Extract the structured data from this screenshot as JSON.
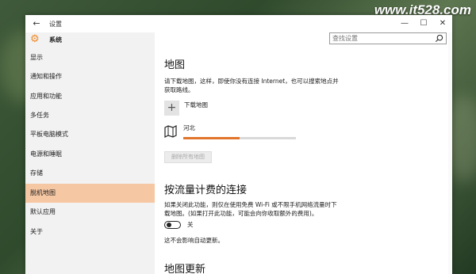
{
  "watermark": "www.it528.com",
  "window": {
    "title": "设置",
    "back_icon": "arrow-left-icon",
    "controls": {
      "minimize": "—",
      "maximize": "☐",
      "close": "✕"
    }
  },
  "sidebar": {
    "header": "系统",
    "items": [
      {
        "label": "显示"
      },
      {
        "label": "通知和操作"
      },
      {
        "label": "应用和功能"
      },
      {
        "label": "多任务"
      },
      {
        "label": "平板电脑模式"
      },
      {
        "label": "电源和睡眠"
      },
      {
        "label": "存储"
      },
      {
        "label": "脱机地图",
        "active": true
      },
      {
        "label": "默认应用"
      },
      {
        "label": "关于"
      }
    ]
  },
  "search": {
    "placeholder": "查找设置",
    "value": ""
  },
  "main": {
    "maps": {
      "title": "地图",
      "desc1": "请下载地图，这样，即使你没有连接 Internet，也可以搜索地点并",
      "desc2": "获取路线。",
      "download_label": "下载地图",
      "map_name": "河北",
      "progress": 0.5,
      "delete_all_label": "删除所有地图"
    },
    "metered": {
      "title": "按流量计费的连接",
      "desc1": "如果关闭此功能，则仅在使用免费 Wi-Fi 或不限手机网络流量时下",
      "desc2": "载地图。(如果打开此功能，可能会向你收取额外的费用)。",
      "toggle_state": "关",
      "auto_update_note": "这不会影响自动更新。"
    },
    "updates": {
      "title": "地图更新"
    }
  },
  "colors": {
    "accent": "#e0752b",
    "active_nav": "#f6c7a3",
    "sidebar_bg": "#f2f2f2"
  }
}
